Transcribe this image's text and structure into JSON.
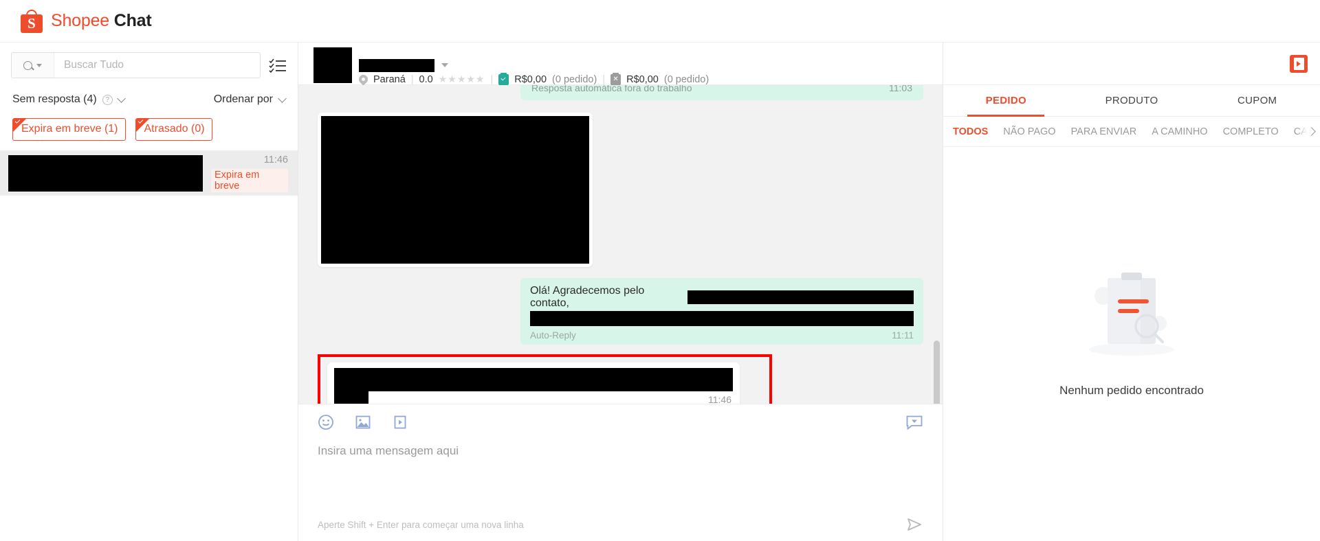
{
  "app": {
    "brand_shopee": "Shopee",
    "brand_chat": "Chat",
    "logo_letter": "S"
  },
  "sidebar": {
    "search": {
      "placeholder": "Buscar Tudo",
      "value": "",
      "search_icon": "search-icon",
      "dropdown_icon": "caret-down-icon"
    },
    "list_toggle_icon": "checklist-icon",
    "filter": {
      "label": "Sem resposta (4)",
      "help_icon": "question-circle-icon",
      "chevron_icon": "chevron-down-icon",
      "sort_label": "Ordenar por",
      "sort_chevron_icon": "chevron-down-icon"
    },
    "chips": [
      {
        "label": "Expira em breve (1)",
        "selected": true
      },
      {
        "label": "Atrasado (0)",
        "selected": true
      }
    ],
    "conversations": [
      {
        "name_redacted": true,
        "time": "11:46",
        "badge": "Expira em breve",
        "selected": true
      }
    ]
  },
  "chat_header": {
    "avatar_redacted": true,
    "name_redacted": true,
    "dropdown_icon": "caret-down-icon",
    "location_icon": "location-pin-icon",
    "location": "Paraná",
    "rating": "0.0",
    "stars": "★★★★★",
    "completed_icon": "receipt-check-icon",
    "completed_amount": "R$0,00",
    "completed_orders": "(0 pedido)",
    "cancelled_icon": "receipt-cancel-icon",
    "cancelled_amount": "R$0,00",
    "cancelled_orders": "(0 pedido)"
  },
  "messages": {
    "system_note": "Resposta automática fora do trabalho",
    "system_note_time": "11:03",
    "image_message": {
      "redacted": true
    },
    "auto_reply": {
      "text": "Olá! Agradecemos pelo contato,",
      "label": "Auto-Reply",
      "time": "11:11"
    },
    "last_message": {
      "redacted": true,
      "time": "11:46",
      "highlighted": true,
      "highlight_color": "#ff0000"
    },
    "cursor_icon": "zoom-in-cursor-icon"
  },
  "composer": {
    "emoji_icon": "emoji-smile-icon",
    "image_icon": "image-icon",
    "video_icon": "video-icon",
    "quick_reply_icon": "quick-reply-icon",
    "placeholder": "Insira uma mensagem aqui",
    "value": "",
    "hint": "Aperte Shift + Enter para começar uma nova linha",
    "send_icon": "send-icon"
  },
  "right_panel": {
    "collapse_icon": "collapse-panel-icon",
    "tabs": [
      {
        "label": "PEDIDO",
        "active": true
      },
      {
        "label": "PRODUTO",
        "active": false
      },
      {
        "label": "CUPOM",
        "active": false
      }
    ],
    "subtabs": [
      {
        "label": "TODOS",
        "active": true
      },
      {
        "label": "NÃO PAGO",
        "active": false
      },
      {
        "label": "PARA ENVIAR",
        "active": false
      },
      {
        "label": "A CAMINHO",
        "active": false
      },
      {
        "label": "COMPLETO",
        "active": false
      },
      {
        "label": "CANC",
        "active": false
      }
    ],
    "subtabs_next_icon": "chevron-right-icon",
    "empty_illustration": "empty-order-clipboard-icon",
    "empty_label": "Nenhum pedido encontrado"
  },
  "colors": {
    "brand": "#ee4d2d",
    "highlight": "#ff0000",
    "bubble_green": "#d7f5e9",
    "chat_bg": "#f2f2f2"
  }
}
